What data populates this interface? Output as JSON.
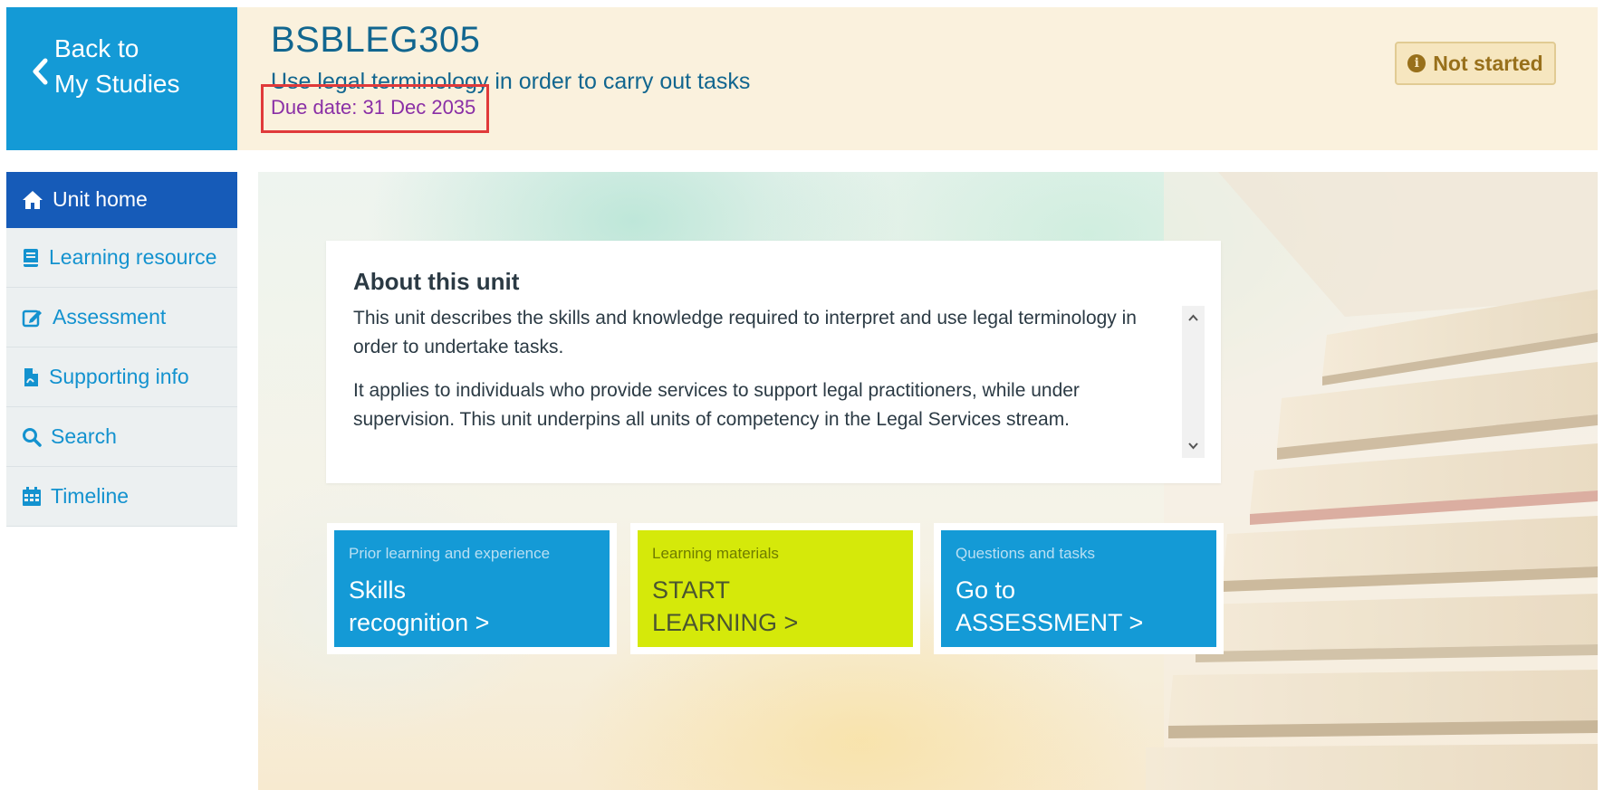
{
  "back_button": {
    "line1": "Back to",
    "line2": "My Studies"
  },
  "header": {
    "unit_code": "BSBLEG305",
    "unit_title": "Use legal terminology in order to carry out tasks",
    "due_date": "Due date: 31 Dec 2035",
    "status": "Not started",
    "status_icon": "info-icon"
  },
  "sidebar": {
    "items": [
      {
        "label": "Unit home",
        "icon": "home-icon",
        "active": true
      },
      {
        "label": "Learning resource",
        "icon": "book-icon",
        "active": false
      },
      {
        "label": "Assessment",
        "icon": "edit-icon",
        "active": false
      },
      {
        "label": "Supporting info",
        "icon": "document-icon",
        "active": false
      },
      {
        "label": "Search",
        "icon": "search-icon",
        "active": false
      },
      {
        "label": "Timeline",
        "icon": "calendar-icon",
        "active": false
      }
    ]
  },
  "about": {
    "title": "About this unit",
    "paragraph1": "This unit describes the skills and knowledge required to interpret and use legal terminology in order to undertake tasks.",
    "paragraph2": "It applies to individuals who provide services to support legal practitioners, while under supervision. This unit underpins all units of competency in the Legal Services stream."
  },
  "tiles": [
    {
      "kicker": "Prior learning and experience",
      "line1": "Skills",
      "line2": "recognition >",
      "color": "#149ad6"
    },
    {
      "kicker": "Learning materials",
      "line1": "START",
      "line2": "LEARNING >",
      "color": "#d5e90a"
    },
    {
      "kicker": "Questions and tasks",
      "line1": "Go to",
      "line2": "ASSESSMENT >",
      "color": "#149ad6"
    }
  ],
  "colors": {
    "accent_blue": "#149ad6",
    "active_nav": "#165bb8",
    "header_bg": "#faf1dd",
    "due_date_text": "#8a2fa6",
    "highlight_box": "#e03a3a"
  }
}
